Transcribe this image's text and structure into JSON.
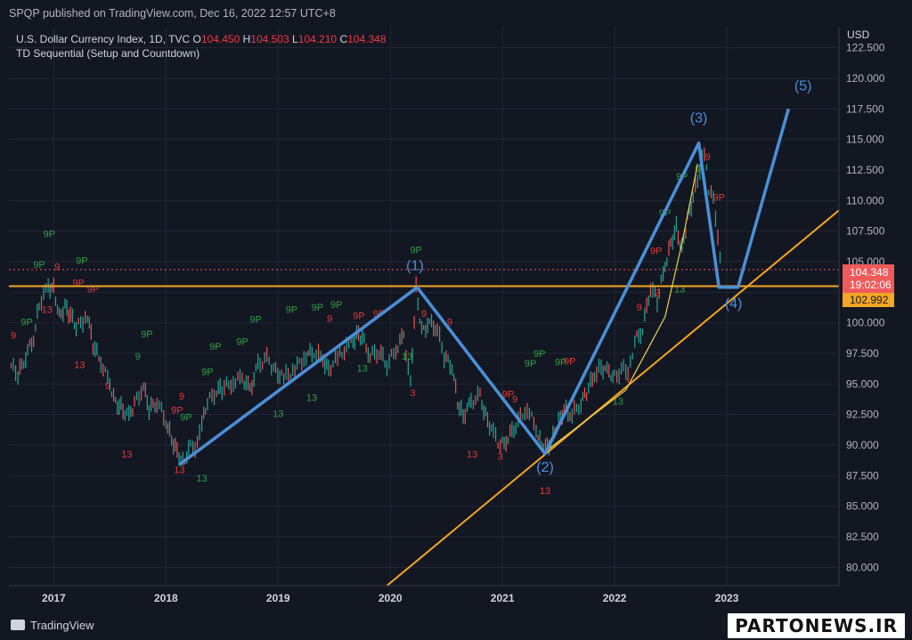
{
  "header": {
    "publisher_line": "SPQP published on TradingView.com, Dec 16, 2022 12:57 UTC+8"
  },
  "legend": {
    "symbol": "U.S. Dollar Currency Index, 1D, TVC",
    "open_label": "O",
    "open_value": "104.450",
    "high_label": "H",
    "high_value": "104.503",
    "low_label": "L",
    "low_value": "104.210",
    "close_label": "C",
    "close_value": "104.348",
    "indicator": "TD Sequential (Setup and Countdown)"
  },
  "price_tags": {
    "last_price": "104.348",
    "countdown": "19:02:06",
    "level": "102.992"
  },
  "footer": {
    "logo_text": "TradingView",
    "watermark": "PARTONEWS.IR"
  },
  "colors": {
    "background": "#131722",
    "grid": "#232736",
    "wave": "#4a90d9",
    "trendline": "#f5a623",
    "curve": "#e8d44d",
    "up": "#26a69a",
    "down": "#ef5350",
    "td_green": "#2ea043",
    "td_red": "#e53935"
  },
  "chart_data": {
    "type": "line",
    "title": "U.S. Dollar Currency Index, 1D, TVC",
    "currency": "USD",
    "ylim": [
      78.5,
      124.0
    ],
    "y_ticks": [
      "80.000",
      "82.500",
      "85.000",
      "87.500",
      "90.000",
      "92.500",
      "95.000",
      "97.500",
      "100.000",
      "102.500",
      "105.000",
      "107.500",
      "110.000",
      "112.500",
      "115.000",
      "117.500",
      "120.000",
      "122.500"
    ],
    "x_ticks": [
      {
        "label": "2017",
        "x": 2017.0
      },
      {
        "label": "2018",
        "x": 2018.0
      },
      {
        "label": "2019",
        "x": 2019.0
      },
      {
        "label": "2020",
        "x": 2020.0
      },
      {
        "label": "2021",
        "x": 2021.0
      },
      {
        "label": "2022",
        "x": 2022.0
      },
      {
        "label": "2023",
        "x": 2023.0
      }
    ],
    "x_range": [
      2016.6,
      2024.0
    ],
    "price_series": [
      [
        2016.62,
        96.5
      ],
      [
        2016.68,
        95.7
      ],
      [
        2016.75,
        97.3
      ],
      [
        2016.82,
        98.8
      ],
      [
        2016.87,
        101.5
      ],
      [
        2016.95,
        103.0
      ],
      [
        2017.0,
        102.8
      ],
      [
        2017.05,
        100.5
      ],
      [
        2017.1,
        101.3
      ],
      [
        2017.15,
        100.6
      ],
      [
        2017.2,
        99.6
      ],
      [
        2017.3,
        100.6
      ],
      [
        2017.35,
        98.2
      ],
      [
        2017.42,
        96.8
      ],
      [
        2017.5,
        95.0
      ],
      [
        2017.55,
        93.5
      ],
      [
        2017.6,
        93.1
      ],
      [
        2017.67,
        92.3
      ],
      [
        2017.72,
        93.4
      ],
      [
        2017.8,
        94.8
      ],
      [
        2017.85,
        92.9
      ],
      [
        2017.92,
        93.6
      ],
      [
        2018.0,
        92.0
      ],
      [
        2018.05,
        90.5
      ],
      [
        2018.1,
        89.5
      ],
      [
        2018.15,
        88.6
      ],
      [
        2018.22,
        89.8
      ],
      [
        2018.28,
        90.0
      ],
      [
        2018.32,
        91.7
      ],
      [
        2018.37,
        93.5
      ],
      [
        2018.45,
        94.5
      ],
      [
        2018.5,
        94.6
      ],
      [
        2018.6,
        95.2
      ],
      [
        2018.68,
        95.5
      ],
      [
        2018.75,
        94.5
      ],
      [
        2018.82,
        96.5
      ],
      [
        2018.9,
        97.1
      ],
      [
        2018.96,
        96.2
      ],
      [
        2019.05,
        95.5
      ],
      [
        2019.15,
        96.2
      ],
      [
        2019.25,
        97.4
      ],
      [
        2019.32,
        97.6
      ],
      [
        2019.4,
        97.0
      ],
      [
        2019.45,
        96.2
      ],
      [
        2019.55,
        97.4
      ],
      [
        2019.65,
        98.3
      ],
      [
        2019.7,
        99.0
      ],
      [
        2019.75,
        98.8
      ],
      [
        2019.82,
        97.3
      ],
      [
        2019.9,
        97.7
      ],
      [
        2019.97,
        96.6
      ],
      [
        2020.05,
        97.8
      ],
      [
        2020.12,
        99.0
      ],
      [
        2020.18,
        95.0
      ],
      [
        2020.23,
        102.8
      ],
      [
        2020.28,
        99.3
      ],
      [
        2020.35,
        100.0
      ],
      [
        2020.42,
        99.5
      ],
      [
        2020.48,
        97.2
      ],
      [
        2020.55,
        96.5
      ],
      [
        2020.6,
        93.5
      ],
      [
        2020.65,
        92.4
      ],
      [
        2020.72,
        93.5
      ],
      [
        2020.8,
        94.0
      ],
      [
        2020.85,
        92.4
      ],
      [
        2020.92,
        91.0
      ],
      [
        2020.98,
        89.9
      ],
      [
        2021.05,
        90.6
      ],
      [
        2021.12,
        91.7
      ],
      [
        2021.22,
        93.1
      ],
      [
        2021.3,
        91.3
      ],
      [
        2021.35,
        90.0
      ],
      [
        2021.4,
        89.8
      ],
      [
        2021.45,
        90.6
      ],
      [
        2021.5,
        92.0
      ],
      [
        2021.55,
        92.9
      ],
      [
        2021.62,
        92.5
      ],
      [
        2021.7,
        93.5
      ],
      [
        2021.75,
        94.3
      ],
      [
        2021.82,
        95.8
      ],
      [
        2021.88,
        96.4
      ],
      [
        2021.95,
        95.9
      ],
      [
        2022.0,
        95.6
      ],
      [
        2022.08,
        96.2
      ],
      [
        2022.12,
        95.6
      ],
      [
        2022.18,
        98.5
      ],
      [
        2022.25,
        99.5
      ],
      [
        2022.32,
        103.0
      ],
      [
        2022.38,
        101.8
      ],
      [
        2022.45,
        104.7
      ],
      [
        2022.5,
        106.5
      ],
      [
        2022.55,
        107.8
      ],
      [
        2022.6,
        106.0
      ],
      [
        2022.65,
        108.5
      ],
      [
        2022.7,
        110.2
      ],
      [
        2022.76,
        112.5
      ],
      [
        2022.8,
        114.1
      ],
      [
        2022.84,
        111.0
      ],
      [
        2022.88,
        110.5
      ],
      [
        2022.92,
        107.0
      ],
      [
        2022.96,
        104.4
      ]
    ],
    "wave_path": [
      [
        2018.12,
        88.4
      ],
      [
        2020.24,
        102.9
      ],
      [
        2021.38,
        89.3
      ],
      [
        2022.75,
        114.7
      ],
      [
        2022.93,
        102.9
      ],
      [
        2023.1,
        102.9
      ],
      [
        2023.55,
        117.5
      ]
    ],
    "wave_labels": [
      {
        "text": "(1)",
        "x": 2020.22,
        "y": 104.3
      },
      {
        "text": "(2)",
        "x": 2021.38,
        "y": 87.8
      },
      {
        "text": "(3)",
        "x": 2022.75,
        "y": 116.4
      },
      {
        "text": "(4)",
        "x": 2023.06,
        "y": 101.2
      },
      {
        "text": "(5)",
        "x": 2023.68,
        "y": 119.0
      }
    ],
    "horizontal_level": 102.992,
    "last_price_line": 104.348,
    "trendline": [
      [
        2019.97,
        78.5
      ],
      [
        2024.0,
        109.2
      ]
    ],
    "td_labels_green": [
      {
        "t": "9P",
        "x": 2016.96,
        "y": 107.0
      },
      {
        "t": "9P",
        "x": 2016.87,
        "y": 104.5
      },
      {
        "t": "9P",
        "x": 2017.25,
        "y": 104.8
      },
      {
        "t": "9P",
        "x": 2016.76,
        "y": 99.8
      },
      {
        "t": "9",
        "x": 2017.75,
        "y": 97.0
      },
      {
        "t": "9P",
        "x": 2017.83,
        "y": 98.8
      },
      {
        "t": "9P",
        "x": 2018.18,
        "y": 92.0
      },
      {
        "t": "9P",
        "x": 2018.37,
        "y": 95.7
      },
      {
        "t": "9P",
        "x": 2018.44,
        "y": 97.8
      },
      {
        "t": "9P",
        "x": 2018.68,
        "y": 98.2
      },
      {
        "t": "9P",
        "x": 2018.8,
        "y": 100.0
      },
      {
        "t": "9P",
        "x": 2019.12,
        "y": 100.8
      },
      {
        "t": "9P",
        "x": 2019.35,
        "y": 101.0
      },
      {
        "t": "9P",
        "x": 2019.52,
        "y": 101.2
      },
      {
        "t": "9P",
        "x": 2020.23,
        "y": 105.7
      },
      {
        "t": "9P",
        "x": 2021.25,
        "y": 96.4
      },
      {
        "t": "9P",
        "x": 2021.33,
        "y": 97.2
      },
      {
        "t": "9P",
        "x": 2021.52,
        "y": 96.5
      },
      {
        "t": "9P",
        "x": 2022.45,
        "y": 108.7
      },
      {
        "t": "9P",
        "x": 2022.6,
        "y": 111.7
      },
      {
        "t": "9",
        "x": 2022.74,
        "y": 112.3
      },
      {
        "t": "13",
        "x": 2018.32,
        "y": 87.0
      },
      {
        "t": "13",
        "x": 2019.0,
        "y": 92.3
      },
      {
        "t": "13",
        "x": 2019.3,
        "y": 93.6
      },
      {
        "t": "13",
        "x": 2019.75,
        "y": 96.0
      },
      {
        "t": "13",
        "x": 2020.15,
        "y": 97.0
      },
      {
        "t": "13",
        "x": 2022.03,
        "y": 93.3
      },
      {
        "t": "13",
        "x": 2022.58,
        "y": 102.5
      }
    ],
    "td_labels_red": [
      {
        "t": "9",
        "x": 2017.03,
        "y": 104.3
      },
      {
        "t": "9P",
        "x": 2017.22,
        "y": 103.0
      },
      {
        "t": "9P",
        "x": 2017.35,
        "y": 102.5
      },
      {
        "t": "9",
        "x": 2016.64,
        "y": 98.7
      },
      {
        "t": "13",
        "x": 2016.94,
        "y": 100.8
      },
      {
        "t": "13",
        "x": 2017.23,
        "y": 96.3
      },
      {
        "t": "9",
        "x": 2017.48,
        "y": 94.6
      },
      {
        "t": "13",
        "x": 2017.65,
        "y": 89.0
      },
      {
        "t": "9P",
        "x": 2018.1,
        "y": 92.6
      },
      {
        "t": "9",
        "x": 2018.14,
        "y": 93.7
      },
      {
        "t": "13",
        "x": 2018.12,
        "y": 87.7
      },
      {
        "t": "9",
        "x": 2019.46,
        "y": 100.1
      },
      {
        "t": "9P",
        "x": 2019.72,
        "y": 100.3
      },
      {
        "t": "9P",
        "x": 2019.9,
        "y": 100.5
      },
      {
        "t": "3",
        "x": 2020.2,
        "y": 94.0
      },
      {
        "t": "9",
        "x": 2020.3,
        "y": 100.5
      },
      {
        "t": "9",
        "x": 2020.53,
        "y": 99.8
      },
      {
        "t": "13",
        "x": 2020.73,
        "y": 89.0
      },
      {
        "t": "3",
        "x": 2020.98,
        "y": 88.8
      },
      {
        "t": "9P",
        "x": 2021.05,
        "y": 93.9
      },
      {
        "t": "9",
        "x": 2021.11,
        "y": 93.5
      },
      {
        "t": "13",
        "x": 2021.38,
        "y": 86.0
      },
      {
        "t": "9P",
        "x": 2021.6,
        "y": 96.6
      },
      {
        "t": "9",
        "x": 2022.22,
        "y": 101.0
      },
      {
        "t": "9P",
        "x": 2022.37,
        "y": 105.6
      },
      {
        "t": "2",
        "x": 2022.38,
        "y": 102.2
      },
      {
        "t": "9P",
        "x": 2022.93,
        "y": 110.0
      },
      {
        "t": "9",
        "x": 2022.83,
        "y": 113.3
      }
    ]
  }
}
